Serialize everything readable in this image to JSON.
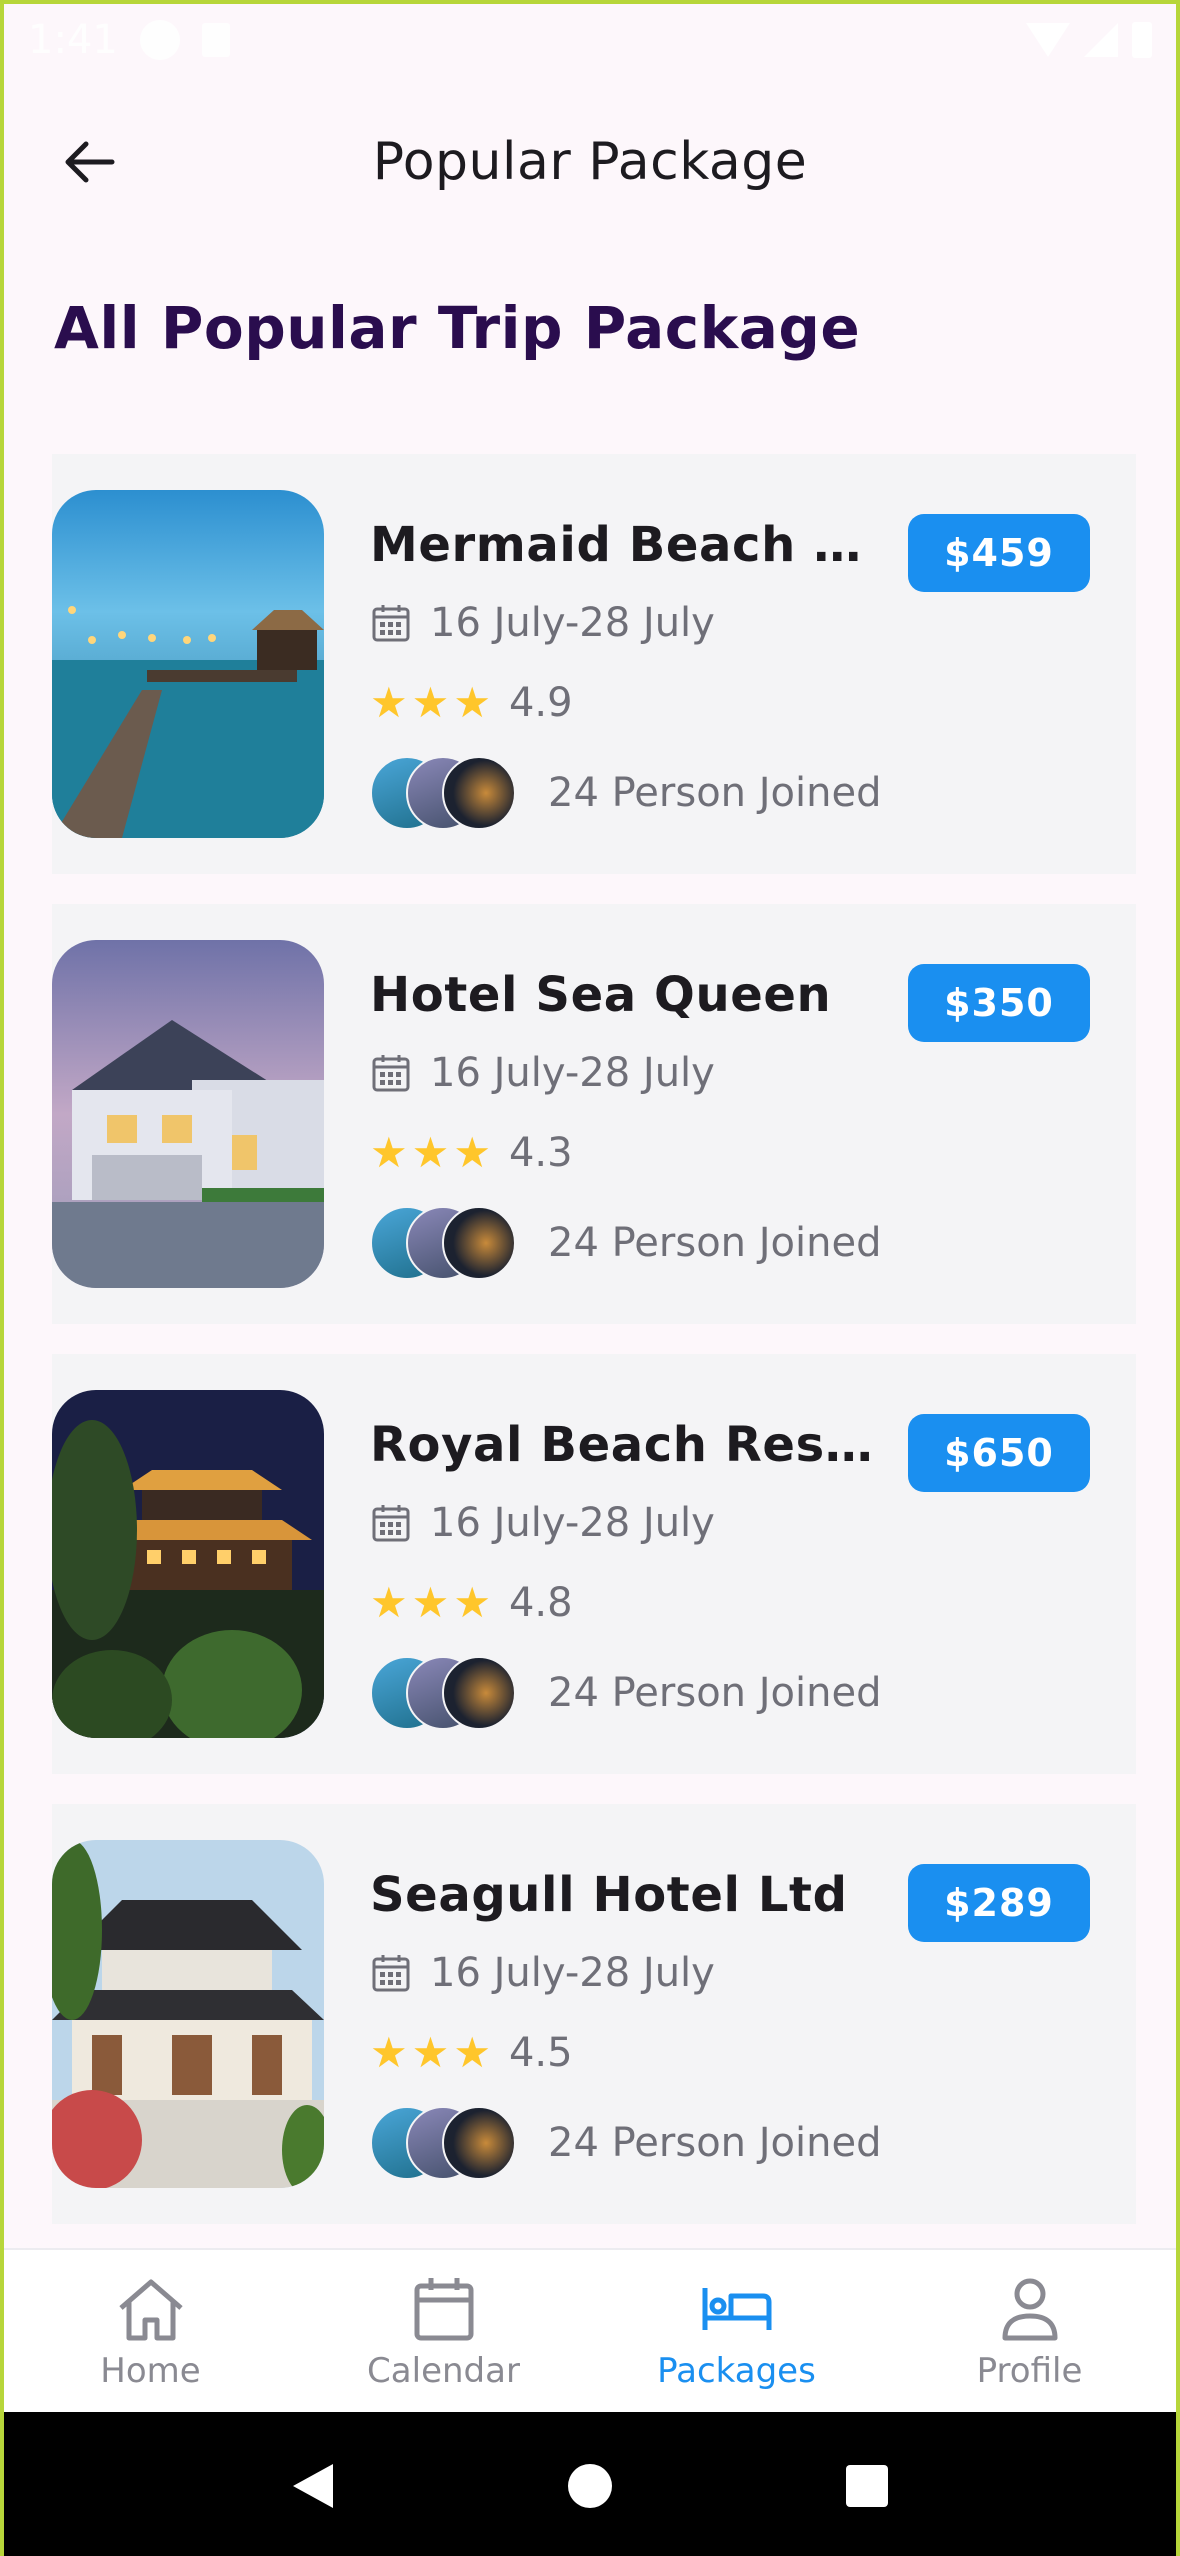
{
  "status_bar": {
    "time": "1:41"
  },
  "header": {
    "title": "Popular Package",
    "back_icon": "arrow-left-icon"
  },
  "section": {
    "title": "All Popular Trip Package"
  },
  "packages": [
    {
      "name": "Mermaid Beach Res...",
      "dates": "16 July-28 July",
      "rating": "4.9",
      "joined": "24 Person Joined",
      "price": "$459",
      "image": "beach-pier-photo"
    },
    {
      "name": "Hotel Sea Queen",
      "dates": "16 July-28 July",
      "rating": "4.3",
      "joined": "24 Person Joined",
      "price": "$350",
      "image": "house-photo"
    },
    {
      "name": "Royal Beach Resort",
      "dates": "16 July-28 July",
      "rating": "4.8",
      "joined": "24 Person Joined",
      "price": "$650",
      "image": "pagoda-night-photo"
    },
    {
      "name": "Seagull Hotel Ltd",
      "dates": "16 July-28 July",
      "rating": "4.5",
      "joined": "24 Person Joined",
      "price": "$289",
      "image": "japanese-temple-photo"
    }
  ],
  "bottom_nav": {
    "items": [
      {
        "label": "Home",
        "icon": "home-icon"
      },
      {
        "label": "Calendar",
        "icon": "calendar-icon"
      },
      {
        "label": "Packages",
        "icon": "bed-icon",
        "active": true
      },
      {
        "label": "Profile",
        "icon": "profile-icon"
      }
    ]
  },
  "colors": {
    "accent": "#1a8ff0",
    "title": "#2a0d4e",
    "star": "#ffc62b",
    "frame": "#b7d63a"
  }
}
